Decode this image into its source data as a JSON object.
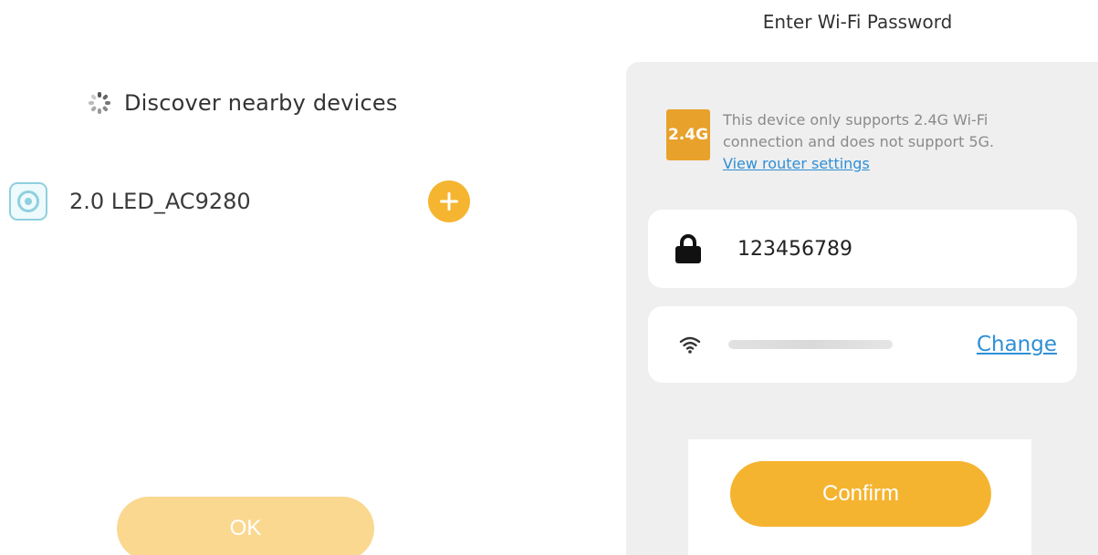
{
  "left_panel": {
    "discover_label": "Discover nearby devices",
    "device": {
      "name": "2.0 LED_AC9280",
      "icon": "device-icon"
    },
    "add_icon": "plus-icon",
    "ok_label": "OK"
  },
  "right_panel": {
    "title": "Enter Wi-Fi Password",
    "notice": {
      "badge": "2.4G",
      "line1": "This device only supports 2.4G Wi-Fi",
      "line2": "connection and does not support 5G.",
      "link": "View router settings"
    },
    "password": {
      "value": "123456789",
      "icon": "lock-icon"
    },
    "wifi": {
      "icon": "wifi-icon",
      "change_label": "Change"
    },
    "confirm_label": "Confirm"
  },
  "colors": {
    "accent": "#f5b430",
    "accent_disabled": "#fad890",
    "link": "#2e8fd6",
    "badge": "#e8a12b",
    "panel_bg": "#efefef"
  }
}
